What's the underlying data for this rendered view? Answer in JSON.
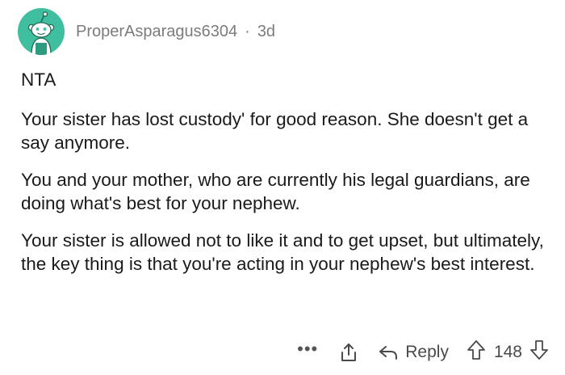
{
  "comment": {
    "author": "ProperAsparagus6304",
    "separator": "·",
    "age": "3d",
    "paragraphs": [
      "NTA",
      "Your sister has lost custody' for good reason. She doesn't get a say anymore.",
      "You and your mother, who are currently his legal guardians, are doing what's best for your nephew.",
      "Your sister is allowed not to like it and to get upset, but ultimately, the key thing is that you're acting in your nephew's best interest."
    ]
  },
  "actions": {
    "more_label": "•••",
    "reply_label": "Reply",
    "score": "148"
  },
  "icons": {
    "avatar": "reddit-snoo-avatar-icon",
    "share": "share-icon",
    "reply": "reply-arrow-icon",
    "upvote": "upvote-arrow-icon",
    "downvote": "downvote-arrow-icon"
  },
  "colors": {
    "avatar_bg": "#3fbf9f",
    "meta_text": "#7c7c7c",
    "body_text": "#1a1a1b",
    "action_text": "#4a4a4a"
  }
}
